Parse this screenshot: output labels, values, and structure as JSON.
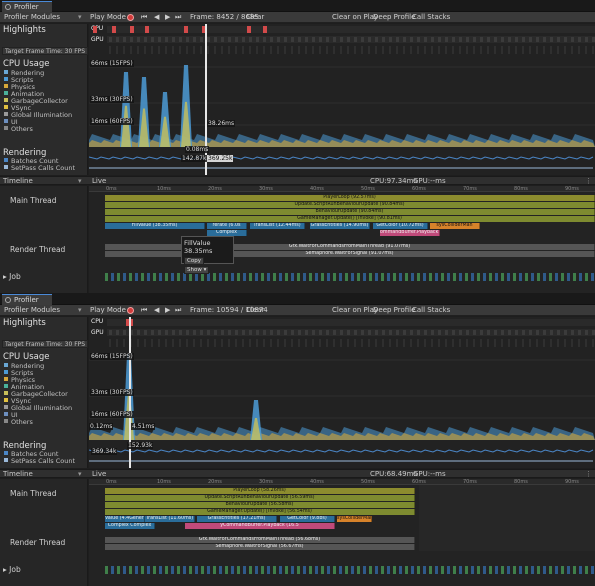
{
  "colors": {
    "rendering": "#6aa7d4",
    "scripts": "#4c9bd6",
    "physics": "#d6a83a",
    "animation": "#4bb19a",
    "gc": "#c8c05a",
    "vsync": "#e0c040",
    "gi": "#9a9a9a",
    "ui": "#6d8fbf",
    "others": "#888",
    "batches": "#4b86c6",
    "setpass": "#9ab8d8",
    "playloop": "#8c8c2e",
    "behaviour": "#7e8b30",
    "fixed": "#2a6d9a",
    "semaphore": "#555",
    "orange": "#d6822a",
    "pink": "#c04a7a",
    "highlight": "#d24a4a"
  },
  "panels": [
    {
      "tab_title": "Profiler",
      "toolbar": {
        "modules": "Profiler Modules",
        "play_mode": "Play Mode",
        "frame": "Frame: 8452 / 8685",
        "clear": "Clear",
        "clear_on_play": "Clear on Play",
        "deep_profile": "Deep Profile",
        "call_stacks": "Call Stacks"
      },
      "highlights": {
        "title": "Highlights",
        "cpu": "CPU",
        "gpu": "GPU",
        "target": "Target Frame Time: 30 FPS"
      },
      "cpu": {
        "title": "CPU Usage",
        "legend": [
          "Rendering",
          "Scripts",
          "Physics",
          "Animation",
          "GarbageCollector",
          "VSync",
          "Global Illumination",
          "UI",
          "Others"
        ],
        "tag_66": "66ms (15FPS)",
        "tag_33": "33ms (30FPS)",
        "tag_16": "16ms (60FPS)",
        "sel_value": "38.26ms",
        "peak_value": ""
      },
      "rendering": {
        "title": "Rendering",
        "legend": [
          "Batches Count",
          "SetPass Calls Count"
        ],
        "v1": "0.08ms",
        "v2": "142.87k",
        "v3": "369.25k"
      },
      "timeline": {
        "view": "Timeline",
        "live": "Live",
        "cpu_label": "CPU:97.34ms",
        "gpu_label": "GPU:--ms",
        "ticks": [
          "0ms",
          "10ms",
          "20ms",
          "30ms",
          "40ms",
          "50ms",
          "60ms",
          "70ms",
          "80ms",
          "90ms"
        ],
        "main_thread": "Main Thread",
        "render_thread": "Render Thread",
        "job": "Job",
        "bars": {
          "playerloop": "PlayerLoop (92.57ms)",
          "script_run": "Update.ScriptRunBehaviourUpdate (90.84ms)",
          "behaviour": "BehaviourUpdate (90.84ms)",
          "gm_update": "GameManager.Update() [Invoke] (90.81ms)",
          "fillvalue": "FillValue (38.35ms)",
          "rerate": "rerate (6.0s",
          "trans": "TransList (12.44ms)",
          "grass": "GrassEntities (14.90ms)",
          "getcolor": "GetColor (10.72ms)",
          "sysc": "sysColliderMan",
          "complex": "Complex",
          "playback": "ommandBuffer.Playback (5)",
          "gfx_wait": "Gfx.WaitForCommandsFromMainThread (91.07ms)",
          "sem_wait": "Semaphore.WaitForSignal (91.07ms)"
        },
        "tooltip": {
          "name": "FillValue",
          "time": "38.35ms",
          "copy": "Copy",
          "show": "Show"
        }
      }
    },
    {
      "tab_title": "Profiler",
      "toolbar": {
        "modules": "Profiler Modules",
        "play_mode": "Play Mode",
        "frame": "Frame: 10594 / 10874",
        "clear": "Clear",
        "clear_on_play": "Clear on Play",
        "deep_profile": "Deep Profile",
        "call_stacks": "Call Stacks"
      },
      "highlights": {
        "title": "Highlights",
        "cpu": "CPU",
        "gpu": "GPU",
        "target": "Target Frame Time: 30 FPS"
      },
      "cpu": {
        "title": "CPU Usage",
        "legend": [
          "Rendering",
          "Scripts",
          "Physics",
          "Animation",
          "GarbageCollector",
          "VSync",
          "Global Illumination",
          "UI",
          "Others"
        ],
        "tag_66": "66ms (15FPS)",
        "tag_33": "33ms (30FPS)",
        "tag_16": "16ms (60FPS)",
        "sel_value": "0.12ms",
        "peak_value": "4.51ms"
      },
      "rendering": {
        "title": "Rendering",
        "legend": [
          "Batches Count",
          "SetPass Calls Count"
        ],
        "v1": "152.93k",
        "v2": "369.34k",
        "v3": ""
      },
      "timeline": {
        "view": "Timeline",
        "live": "Live",
        "cpu_label": "CPU:68.49ms",
        "gpu_label": "GPU:--ms",
        "ticks": [
          "0ms",
          "10ms",
          "20ms",
          "30ms",
          "40ms",
          "50ms",
          "60ms",
          "70ms",
          "80ms",
          "90ms"
        ],
        "main_thread": "Main Thread",
        "render_thread": "Render Thread",
        "job": "Job",
        "bars": {
          "playerloop": "PlayerLoop (58.26ms)",
          "script_run": "Update.ScriptRunBehaviourUpdate (56.59ms)",
          "behaviour": "BehaviourUpdate (56.58ms)",
          "gm_update": "GameManager.Update() [Invoke] (56.54ms)",
          "fillvalue": "Value (4.4Generate (4.7s",
          "rerate": "TransList (11.60ms)",
          "trans": "GrassEntities (17.21ms)",
          "grass": "GetColor (9.8bs)",
          "getcolor": "sysColliderMan",
          "sysc": "",
          "complex": "Complex  Complex",
          "playback": "yCommandBuffer.Playback (16.5",
          "gfx_wait": "Gfx.WaitForCommandsFromMainThread (56.68ms)",
          "sem_wait": "Semaphore.WaitForSignal (56.67ms)"
        },
        "tooltip": null
      }
    }
  ]
}
